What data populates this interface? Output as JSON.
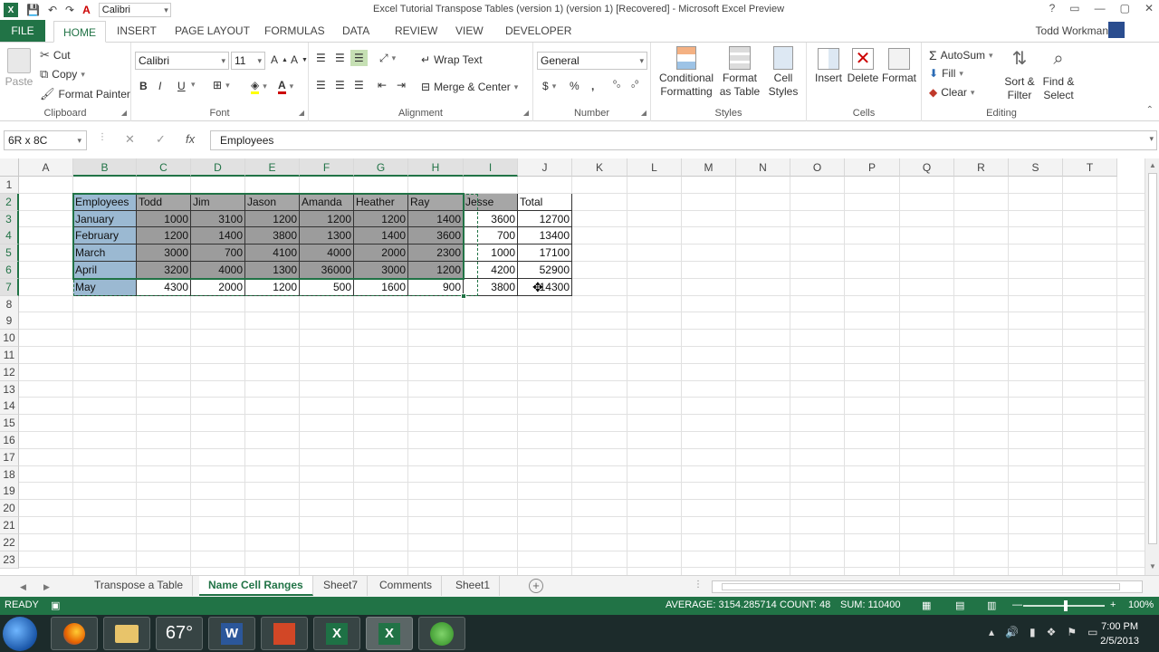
{
  "colors": {
    "accent": "#217346",
    "header_fill": "#a6a6a6",
    "first_col_fill": "#9bb9d2",
    "taskbar": "#1c2b2b"
  },
  "titlebar": {
    "qat_font": "Calibri",
    "title": "Excel Tutorial Transpose Tables (version 1) (version 1) [Recovered] - Microsoft Excel Preview",
    "controls": [
      "?",
      "▭",
      "—",
      "▢",
      "✕"
    ]
  },
  "tabs": {
    "file": "FILE",
    "items": [
      "HOME",
      "INSERT",
      "PAGE LAYOUT",
      "FORMULAS",
      "DATA",
      "REVIEW",
      "VIEW",
      "DEVELOPER"
    ],
    "active": "HOME",
    "user": "Todd Workman"
  },
  "ribbon": {
    "clipboard": {
      "label": "Clipboard",
      "paste": "Paste",
      "cut": "Cut",
      "copy": "Copy",
      "format_painter": "Format Painter"
    },
    "font": {
      "label": "Font",
      "name": "Calibri",
      "size": "11",
      "bold": "B",
      "italic": "I",
      "underline": "U"
    },
    "alignment": {
      "label": "Alignment",
      "wrap_text": "Wrap Text",
      "merge_center": "Merge & Center"
    },
    "number": {
      "label": "Number",
      "format": "General",
      "currency": "$",
      "percent": "%",
      "comma": ","
    },
    "styles": {
      "label": "Styles",
      "conditional": "Conditional Formatting",
      "format_table": "Format as Table",
      "cell_styles": "Cell Styles"
    },
    "cells": {
      "label": "Cells",
      "insert": "Insert",
      "delete": "Delete",
      "format": "Format"
    },
    "editing": {
      "label": "Editing",
      "autosum": "AutoSum",
      "fill": "Fill",
      "clear": "Clear",
      "sort_filter": "Sort & Filter",
      "find_select": "Find & Select"
    }
  },
  "formula_bar": {
    "name_box": "6R x 8C",
    "fx": "fx",
    "cancel": "✕",
    "enter": "✓",
    "value": "Employees"
  },
  "grid": {
    "columns": [
      "A",
      "B",
      "C",
      "D",
      "E",
      "F",
      "G",
      "H",
      "I",
      "J",
      "K",
      "L",
      "M",
      "N",
      "O",
      "P",
      "Q",
      "R",
      "S",
      "T"
    ],
    "rows": [
      "1",
      "2",
      "3",
      "4",
      "5",
      "6",
      "7",
      "8",
      "9",
      "10",
      "11",
      "12",
      "13",
      "14",
      "15",
      "16",
      "17",
      "18",
      "19",
      "20",
      "21",
      "22",
      "23"
    ],
    "table": {
      "headers": [
        "Employees",
        "Todd",
        "Jim",
        "Jason",
        "Amanda",
        "Heather",
        "Ray",
        "Jesse",
        "Total"
      ],
      "rows": [
        [
          "January",
          "1000",
          "3100",
          "1200",
          "1200",
          "1200",
          "1400",
          "3600",
          "12700"
        ],
        [
          "February",
          "1200",
          "1400",
          "3800",
          "1300",
          "1400",
          "3600",
          "700",
          "13400"
        ],
        [
          "March",
          "3000",
          "700",
          "4100",
          "4000",
          "2000",
          "2300",
          "1000",
          "17100"
        ],
        [
          "April",
          "3200",
          "4000",
          "1300",
          "36000",
          "3000",
          "1200",
          "4200",
          "52900"
        ],
        [
          "May",
          "4300",
          "2000",
          "1200",
          "500",
          "1600",
          "900",
          "3800",
          "14300"
        ]
      ]
    }
  },
  "sheets": {
    "tabs": [
      "Transpose a Table",
      "Name Cell Ranges",
      "Sheet7",
      "Comments",
      "Sheet1"
    ],
    "active": "Name Cell Ranges"
  },
  "status": {
    "mode": "READY",
    "average": "AVERAGE: 3154.285714",
    "count": "COUNT: 48",
    "sum": "SUM: 110400",
    "zoom": "100%"
  },
  "taskbar": {
    "weather": "67°",
    "time": "7:00 PM",
    "date": "2/5/2013"
  }
}
